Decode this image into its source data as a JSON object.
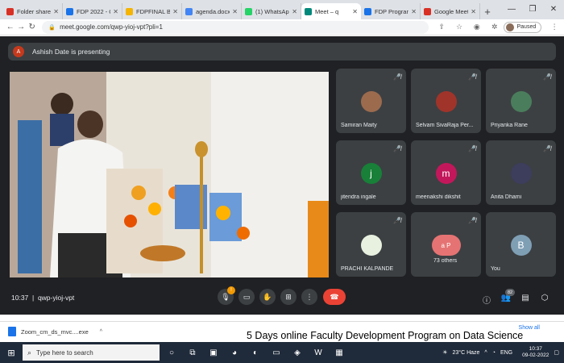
{
  "browser": {
    "tabs": [
      {
        "label": "Folder shared",
        "color": "#d93025",
        "active": false
      },
      {
        "label": "FDP 2022 - G",
        "color": "#1a73e8",
        "active": false
      },
      {
        "label": "FDPFINAL BA",
        "color": "#f4b400",
        "active": false
      },
      {
        "label": "agenda.docx",
        "color": "#4285f4",
        "active": false
      },
      {
        "label": "(1) WhatsApp",
        "color": "#25d366",
        "active": false
      },
      {
        "label": "Meet – q",
        "color": "#00897b",
        "active": true
      },
      {
        "label": "FDP Program",
        "color": "#1a73e8",
        "active": false
      },
      {
        "label": "Google Meet",
        "color": "#d93025",
        "active": false
      }
    ],
    "url": "meet.google.com/qwp-yioj-vpt?pli=1",
    "paused_label": "Paused"
  },
  "meet": {
    "presenting_initial": "A",
    "presenting_text": "Ashish Date is presenting",
    "participants": [
      {
        "name": "Samiran Maity",
        "initial": "",
        "color": "#9c6b4e"
      },
      {
        "name": "Selvam SivaRaja Per...",
        "initial": "",
        "color": "#a0342a"
      },
      {
        "name": "Priyanka Rane",
        "initial": "",
        "color": "#4a7d5c"
      },
      {
        "name": "jitendra ingale",
        "initial": "j",
        "color": "#188038"
      },
      {
        "name": "meenakshi dikshit",
        "initial": "m",
        "color": "#c2185b"
      },
      {
        "name": "Anita Dhami",
        "initial": "",
        "color": "#3d3d5c"
      },
      {
        "name": "PRACHI KALPANDE",
        "initial": "",
        "color": "#e8f0e0"
      },
      {
        "name": "73 others",
        "initial": "a P",
        "color": "#e57373"
      },
      {
        "name": "You",
        "initial": "B",
        "color": "#7f9fb5"
      }
    ],
    "time": "10:37",
    "meeting_code": "qwp-yioj-vpt",
    "mic_badge": "!",
    "people_count": "82"
  },
  "download": {
    "file": "Zoom_cm_ds_mvc....exe",
    "show_all": "Show all"
  },
  "caption": "5 Days online Faculty Development Program on Data Science",
  "taskbar": {
    "search_placeholder": "Type here to search",
    "weather": "23°C  Haze",
    "lang": "ENG",
    "time": "10:37",
    "date": "09-02-2022"
  }
}
